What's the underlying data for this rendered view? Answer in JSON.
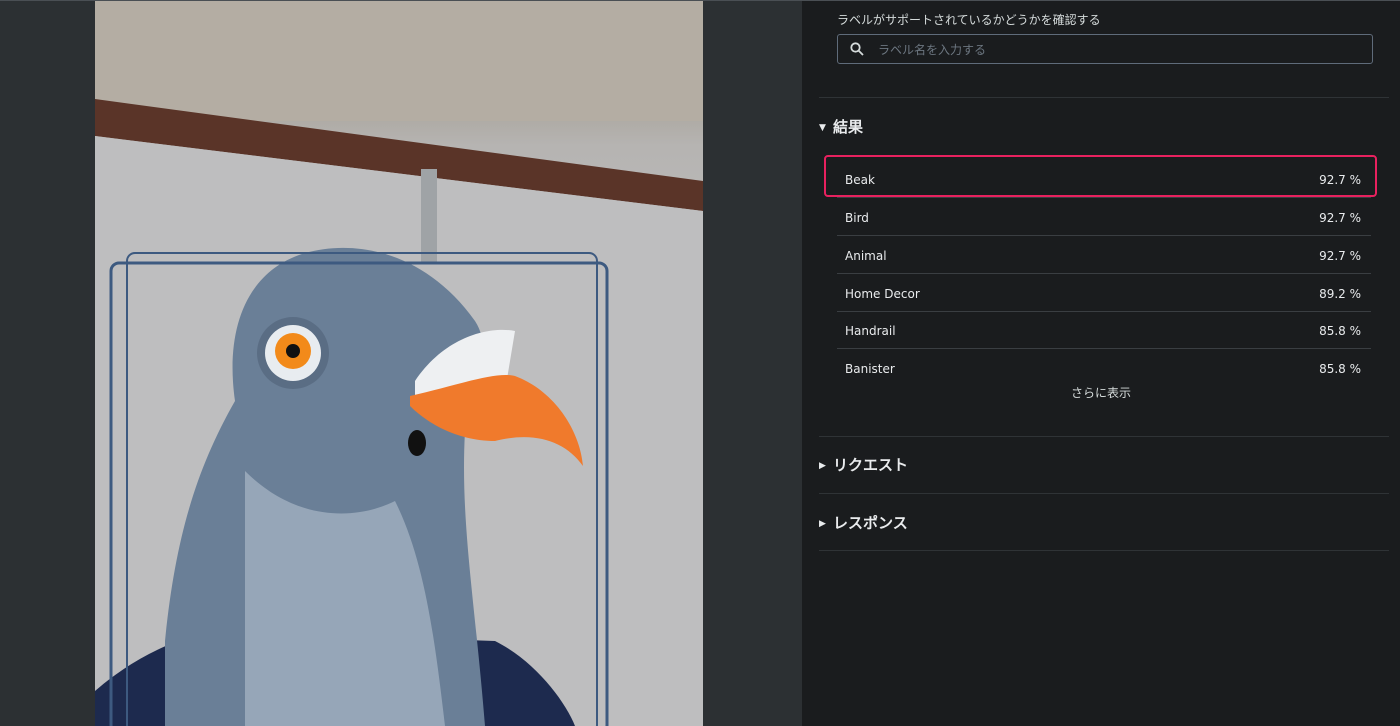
{
  "search": {
    "caption": "ラベルがサポートされているかどうかを確認する",
    "placeholder": "ラベル名を入力する"
  },
  "results": {
    "title": "結果",
    "expanded": true,
    "items": [
      {
        "label": "Beak",
        "confidence": "92.7 %"
      },
      {
        "label": "Bird",
        "confidence": "92.7 %"
      },
      {
        "label": "Animal",
        "confidence": "92.7 %"
      },
      {
        "label": "Home Decor",
        "confidence": "89.2 %"
      },
      {
        "label": "Handrail",
        "confidence": "85.8 %"
      },
      {
        "label": "Banister",
        "confidence": "85.8 %"
      }
    ],
    "show_more": "さらに表示"
  },
  "request": {
    "title": "リクエスト",
    "expanded": false
  },
  "response": {
    "title": "レスポンス",
    "expanded": false
  },
  "colors": {
    "highlight": "#e8215f",
    "panel_bg": "#1a1c1e",
    "viewer_bg": "#2c3033"
  }
}
